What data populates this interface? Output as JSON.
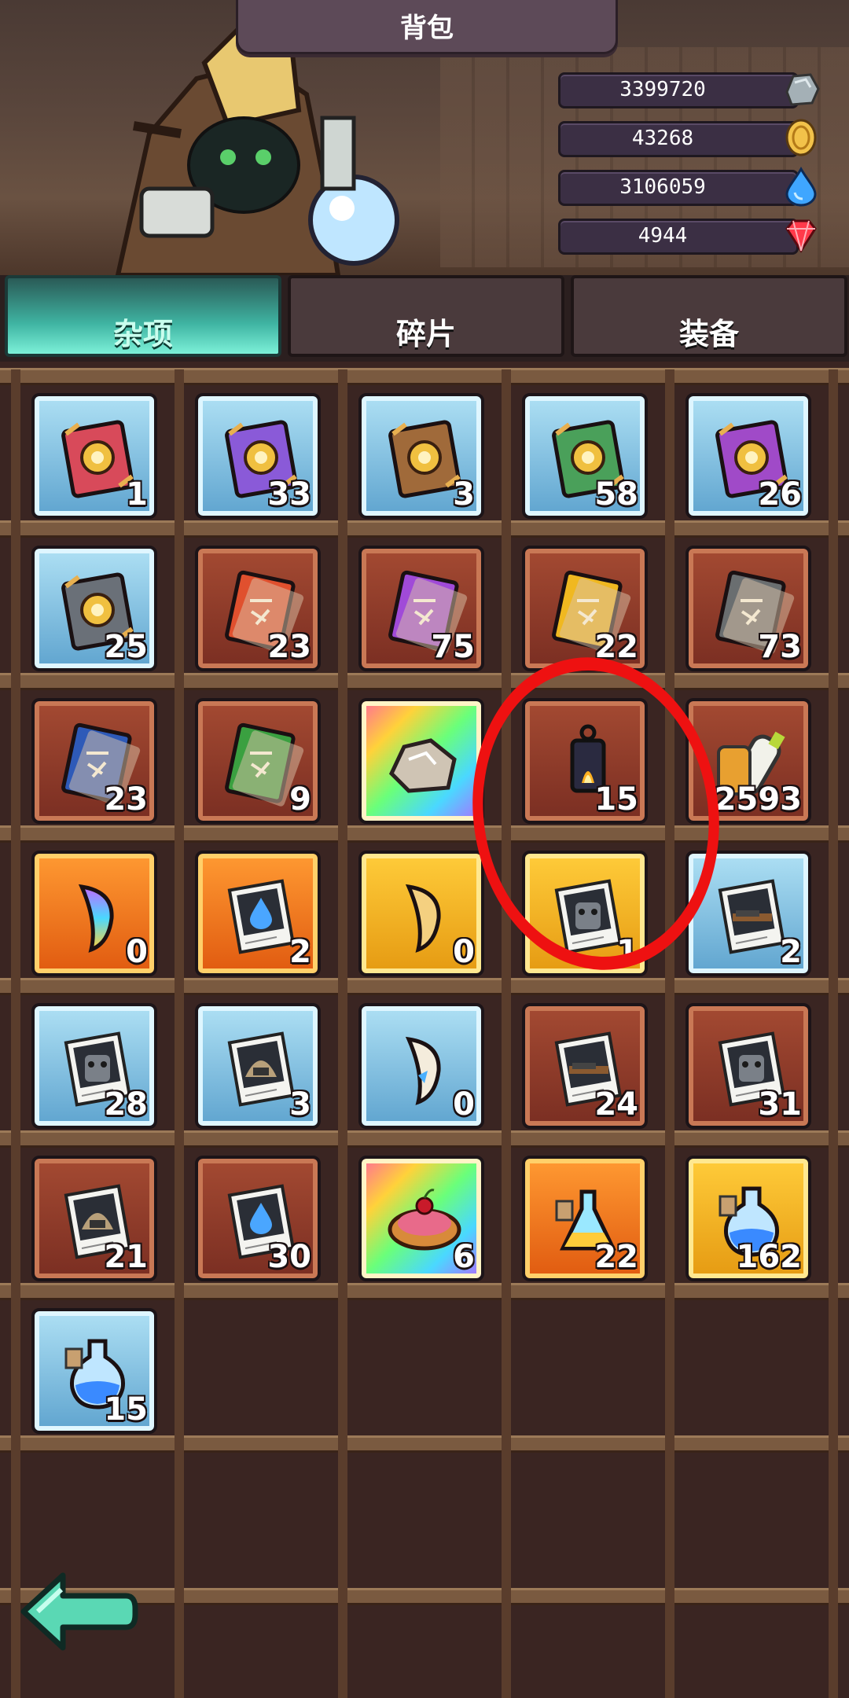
{
  "title": "背包",
  "resources": [
    {
      "name": "stone",
      "value": "3399720",
      "icon": "stone-ore-icon",
      "color": "#9aa6ae"
    },
    {
      "name": "gold",
      "value": "43268",
      "icon": "gold-coin-icon",
      "color": "#f2c24a"
    },
    {
      "name": "water",
      "value": "3106059",
      "icon": "water-drop-icon",
      "color": "#3fa6ff"
    },
    {
      "name": "gem",
      "value": "4944",
      "icon": "red-gem-icon",
      "color": "#ff3a4a"
    }
  ],
  "tabs": [
    {
      "label": "杂项",
      "active": true
    },
    {
      "label": "碎片",
      "active": false
    },
    {
      "label": "装备",
      "active": false
    }
  ],
  "items": [
    {
      "icon": "red-gear-book-icon",
      "frame": "blue",
      "count": "1"
    },
    {
      "icon": "purple-gear-book-icon",
      "frame": "blue",
      "count": "33"
    },
    {
      "icon": "brown-gear-book-icon",
      "frame": "blue",
      "count": "3"
    },
    {
      "icon": "green-gear-book-icon",
      "frame": "blue",
      "count": "58"
    },
    {
      "icon": "violet-gear-book-icon",
      "frame": "blue",
      "count": "26"
    },
    {
      "icon": "gray-gear-book-icon",
      "frame": "blue",
      "count": "25"
    },
    {
      "icon": "red-tome-icon",
      "frame": "red",
      "count": "23"
    },
    {
      "icon": "purple-tome-icon",
      "frame": "red",
      "count": "75"
    },
    {
      "icon": "yellow-tome-icon",
      "frame": "red",
      "count": "22"
    },
    {
      "icon": "gray-tome-icon",
      "frame": "red",
      "count": "73"
    },
    {
      "icon": "blue-tome-icon",
      "frame": "red",
      "count": "23"
    },
    {
      "icon": "green-tome-icon",
      "frame": "red",
      "count": "9"
    },
    {
      "icon": "rock-icon",
      "frame": "rainbow",
      "count": ""
    },
    {
      "icon": "lantern-icon",
      "frame": "red",
      "count": "15"
    },
    {
      "icon": "milk-bottle-icon",
      "frame": "red",
      "count": "2593"
    },
    {
      "icon": "rainbow-horn-icon",
      "frame": "orange",
      "count": "0"
    },
    {
      "icon": "water-drop-photo-icon",
      "frame": "orange",
      "count": "2"
    },
    {
      "icon": "horn-icon",
      "frame": "gold",
      "count": "0"
    },
    {
      "icon": "knight-photo-icon",
      "frame": "gold",
      "count": "1"
    },
    {
      "icon": "gun-photo-icon",
      "frame": "blue",
      "count": "2"
    },
    {
      "icon": "knight-photo-icon",
      "frame": "blue",
      "count": "28"
    },
    {
      "icon": "hood-photo-icon",
      "frame": "blue",
      "count": "3"
    },
    {
      "icon": "white-horn-icon",
      "frame": "blue",
      "count": "0"
    },
    {
      "icon": "gun-photo-icon",
      "frame": "red",
      "count": "24"
    },
    {
      "icon": "knight-photo-icon",
      "frame": "red",
      "count": "31"
    },
    {
      "icon": "hood-photo-icon",
      "frame": "red",
      "count": "21"
    },
    {
      "icon": "water-drop-photo-icon",
      "frame": "red",
      "count": "30"
    },
    {
      "icon": "cherry-pie-icon",
      "frame": "rainbow",
      "count": "6"
    },
    {
      "icon": "rainbow-potion-icon",
      "frame": "orange",
      "count": "22"
    },
    {
      "icon": "blue-potion-icon",
      "frame": "gold",
      "count": "162"
    },
    {
      "icon": "blue-potion-icon",
      "frame": "blue",
      "count": "15"
    }
  ],
  "back_button_icon": "back-arrow-icon",
  "annotation_color": "#ee1111"
}
